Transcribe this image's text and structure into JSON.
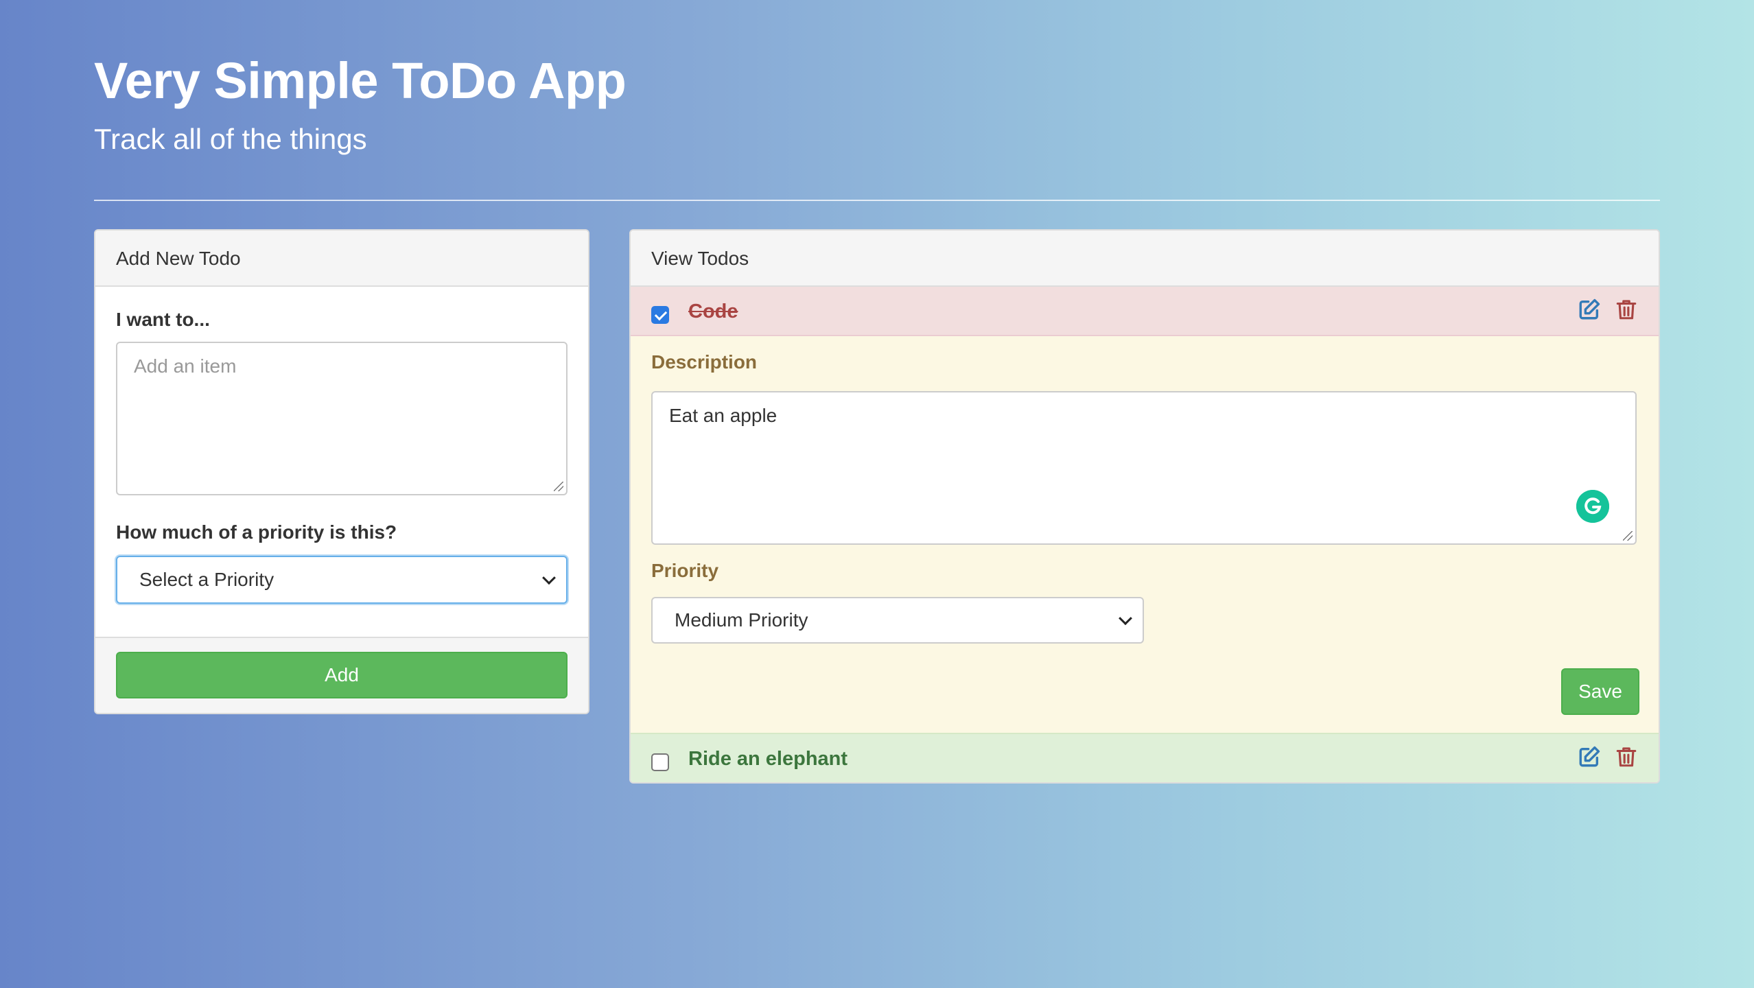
{
  "header": {
    "title": "Very Simple ToDo App",
    "subtitle": "Track all of the things"
  },
  "add_panel": {
    "heading": "Add New Todo",
    "item_label": "I want to...",
    "item_placeholder": "Add an item",
    "item_value": "",
    "priority_label": "How much of a priority is this?",
    "priority_selected": "Select a Priority",
    "add_label": "Add"
  },
  "view_panel": {
    "heading": "View Todos",
    "todos": [
      {
        "title": "Code",
        "completed": true,
        "expanded": true,
        "description_label": "Description",
        "description": "Eat an apple",
        "priority_label": "Priority",
        "priority_selected": "Medium Priority",
        "save_label": "Save",
        "icons": [
          "edit-icon",
          "trash-icon"
        ]
      },
      {
        "title": "Ride an elephant",
        "completed": false,
        "expanded": false,
        "icons": [
          "edit-icon",
          "trash-icon"
        ]
      }
    ]
  },
  "colors": {
    "success": "#5cb85c",
    "danger_text": "#a94442",
    "danger_bg": "#f2dede",
    "success_text": "#3c763d",
    "success_bg": "#dff0d8",
    "warning_text": "#8a6d3b",
    "warning_bg": "#fcf8e3",
    "edit_icon": "#337ab7",
    "checkbox_checked": "#2a7ae2",
    "grammarly": "#15c39a"
  }
}
